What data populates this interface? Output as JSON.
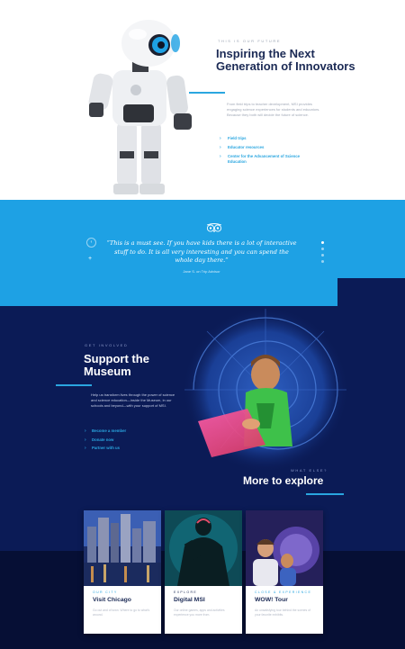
{
  "hero": {
    "eyebrow": "THIS IS OUR FUTURE",
    "title": "Inspiring the Next Generation of Innovators",
    "body": "From field trips to teacher development, MSI provides engaging science experiences for students and educators. Because they both will decide the future of science.",
    "links": [
      {
        "label": "Field trips"
      },
      {
        "label": "Educator resources"
      },
      {
        "label": "Center for the Advancement of Science Education"
      }
    ]
  },
  "quote": {
    "text": "“This is a must see. If you have kids there is a lot of interactive stuff to do. It is all very interesting and you can spend the whole day there.”",
    "author": "Jane S. on Trip Advisor",
    "slides_total": 4,
    "slide_active": 1
  },
  "support": {
    "eyebrow": "GET INVOLVED",
    "title": "Support the Museum",
    "body": "Help us transform lives through the power of science and science education—inside the Museum, in our schools and beyond—with your support of MSI.",
    "links": [
      {
        "label": "Become a member"
      },
      {
        "label": "Donate now"
      },
      {
        "label": "Partner with us"
      }
    ]
  },
  "more": {
    "eyebrow": "WHAT ELSE?",
    "title": "More to explore"
  },
  "cards": [
    {
      "tag": "OUR CITY",
      "title": "Visit Chicago",
      "text": "Go out and of town. Where to go to what's around."
    },
    {
      "tag": "EXPLORE",
      "title": "Digital MSI",
      "text": "Our online games, apps and activities experience you more from."
    },
    {
      "tag": "CLOSE & EXPERIENCE",
      "title": "WOW! Tour",
      "text": "An unsatisfying tour behind the scenes of your favorite exhibits."
    }
  ],
  "colors": {
    "accent": "#2aa6e0",
    "quote_band": "#1ea1e4",
    "navy": "#0b1b56",
    "heading_dark": "#1b2a55"
  }
}
